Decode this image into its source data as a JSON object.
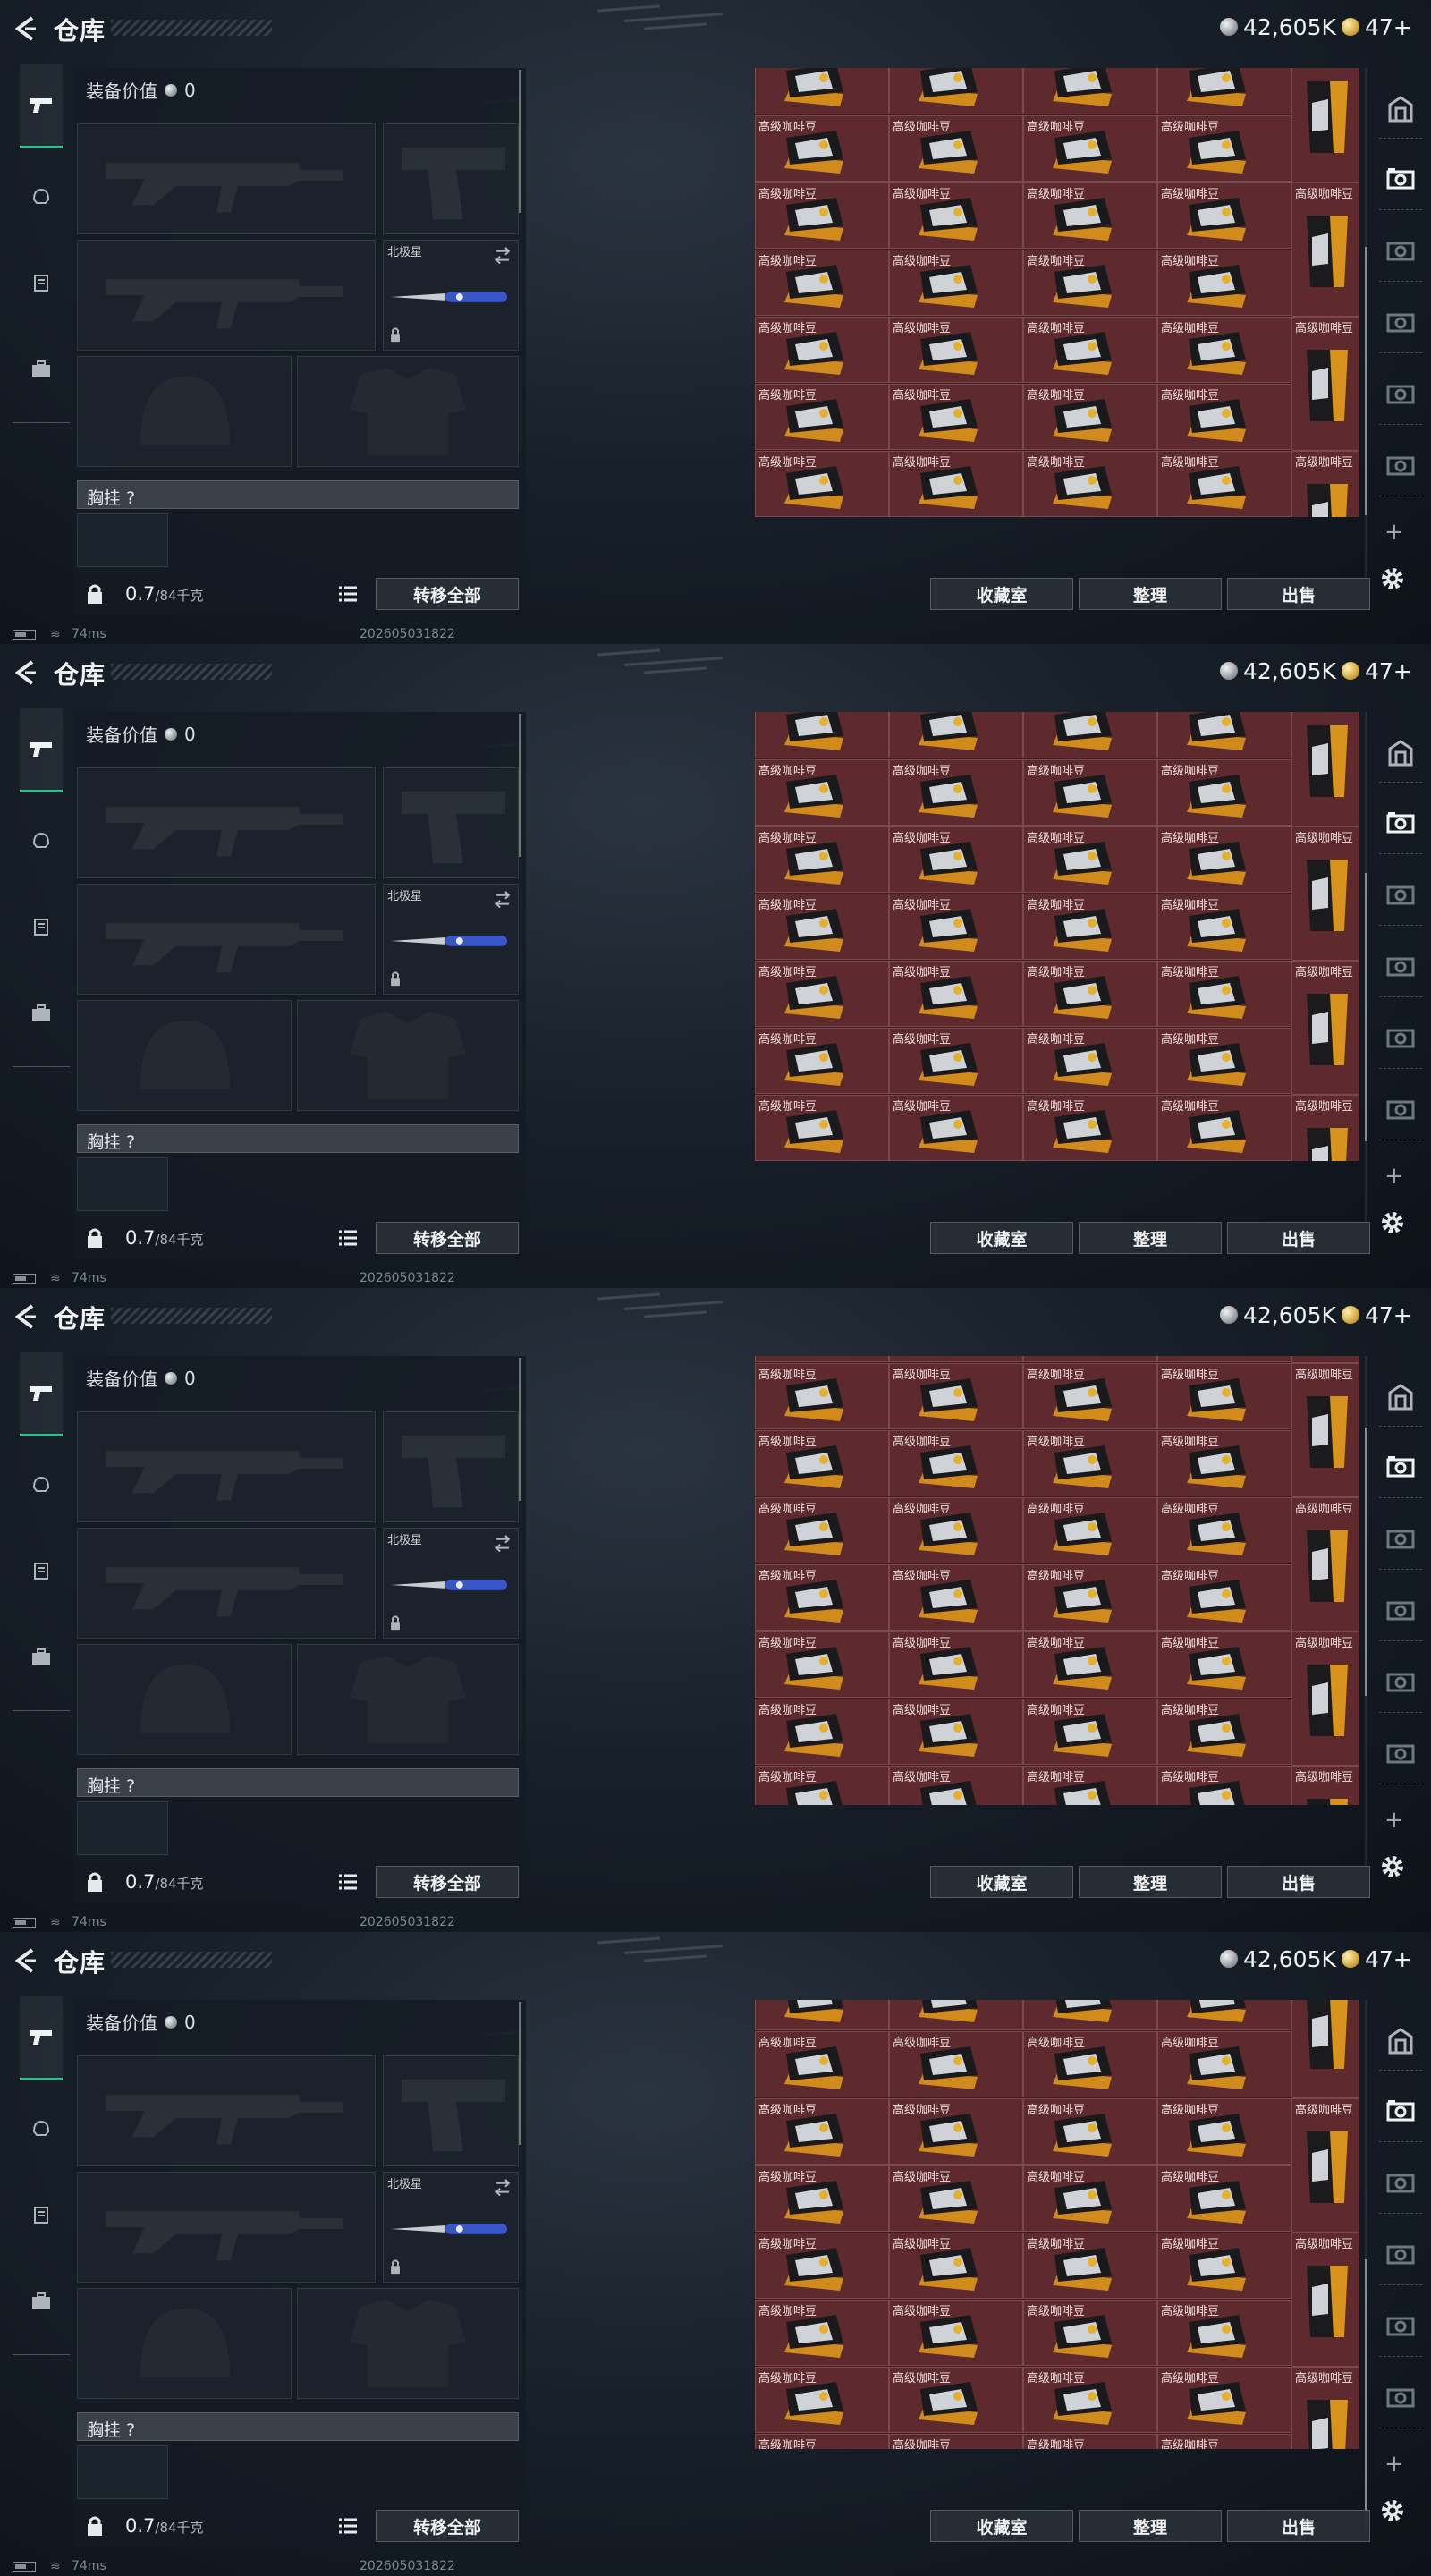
{
  "header": {
    "title": "仓库",
    "silver_amount": "42,605K",
    "gold_amount": "47+"
  },
  "equipment": {
    "value_label": "装备价值",
    "value": "0",
    "knife_slot_label": "北极星",
    "chest_label": "胸挂 ?",
    "weight_current": "0.7",
    "weight_max": "/84千克",
    "transfer_all_label": "转移全部"
  },
  "actions": {
    "collection_label": "收藏室",
    "sort_label": "整理",
    "sell_label": "出售"
  },
  "status": {
    "ping": "74ms",
    "build_id": "202605031822"
  },
  "inventory": {
    "item_name": "高级咖啡豆"
  },
  "colors": {
    "accent": "#2fc08a",
    "cell_bg": "#5e2a2e"
  },
  "icons": {
    "back": "back-arrow-icon",
    "leftnav": [
      "pistol-icon",
      "helmet-icon",
      "vest-icon",
      "briefcase-icon"
    ],
    "rightnav": [
      "door-icon",
      "camera-icon",
      "camera-icon",
      "camera-icon",
      "camera-icon",
      "camera-icon"
    ],
    "settings": "gear-icon"
  }
}
